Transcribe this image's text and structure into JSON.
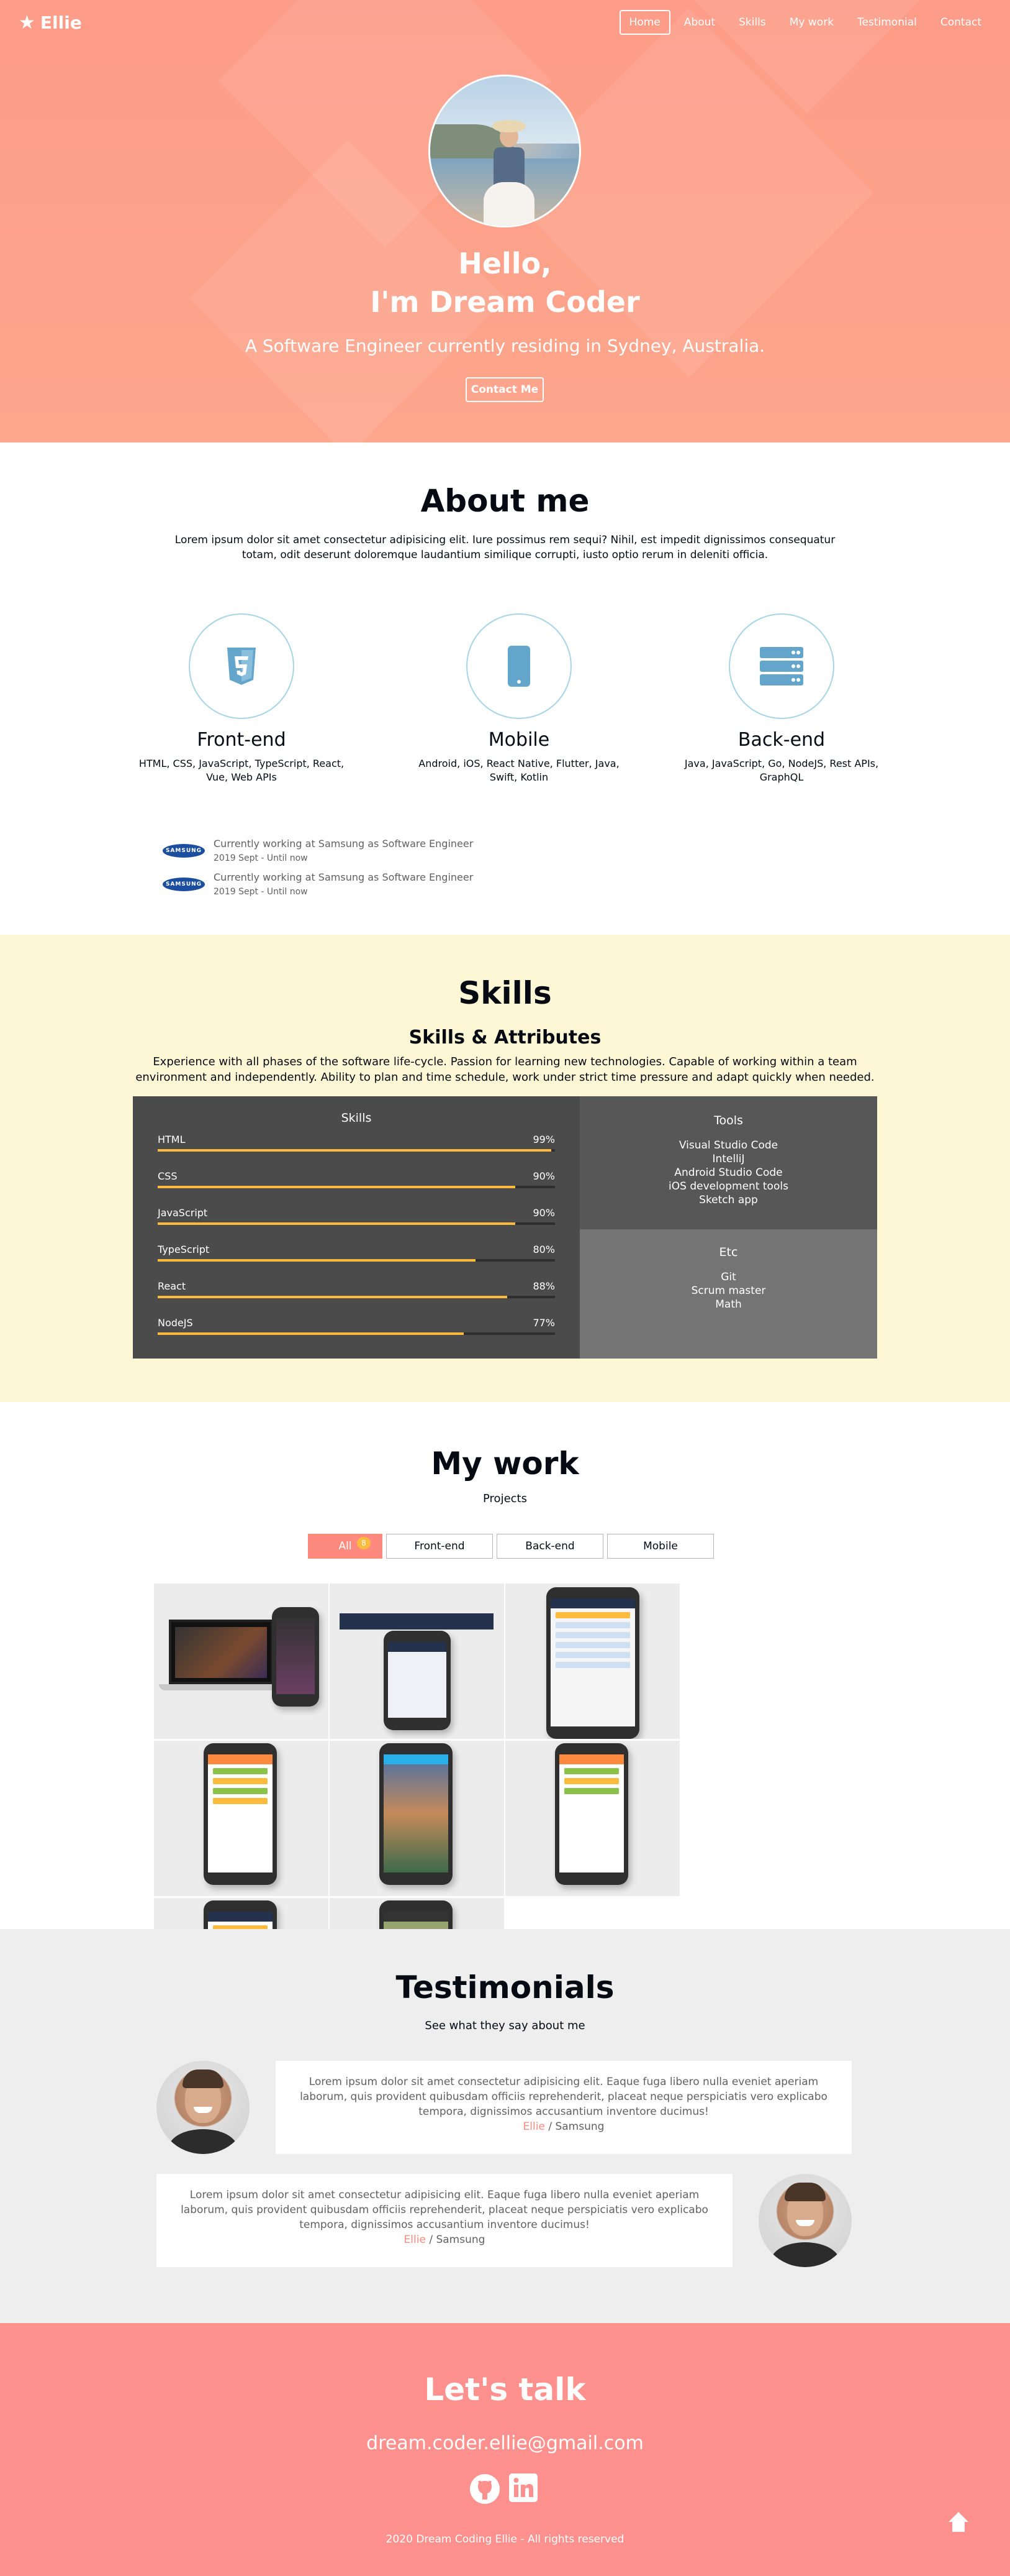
{
  "navbar": {
    "logo": "Ellie",
    "menu": [
      "Home",
      "About",
      "Skills",
      "My work",
      "Testimonial",
      "Contact"
    ]
  },
  "home": {
    "title_line1": "Hello,",
    "title_line2": "I'm Dream Coder",
    "description": "A Software Engineer currently residing in Sydney, Australia.",
    "contact_button": "Contact Me"
  },
  "about": {
    "title": "About me",
    "description": "Lorem ipsum dolor sit amet consectetur adipisicing elit. Iure possimus rem sequi? Nihil, est impedit dignissimos consequatur totam, odit deserunt doloremque laudantium similique corrupti, iusto optio rerum in deleniti officia.",
    "majors": [
      {
        "title": "Front-end",
        "desc": "HTML, CSS, JavaScript, TypeScript, React, Vue, Web APIs",
        "icon": "html5-icon"
      },
      {
        "title": "Mobile",
        "desc": "Android, iOS, React Native, Flutter, Java, Swift, Kotlin",
        "icon": "mobile-icon"
      },
      {
        "title": "Back-end",
        "desc": "Java, JavaScript, Go, NodeJS, Rest APIs, GraphQL",
        "icon": "server-icon"
      }
    ],
    "jobs": [
      {
        "logo": "SAMSUNG",
        "name": "Currently working at Samsung as Software Engineer",
        "period": "2019 Sept - Until now"
      },
      {
        "logo": "SAMSUNG",
        "name": "Currently working at Samsung as Software Engineer",
        "period": "2019 Sept - Until now"
      }
    ]
  },
  "skills": {
    "title": "Skills",
    "subtitle": "Skills & Attributes",
    "description": "Experience with all phases of the software life-cycle. Passion for learning new technologies. Capable of working within a team environment and independently. Ability to plan and time schedule, work under strict time pressure and adapt quickly when needed.",
    "coding_title": "Skills",
    "coding": [
      {
        "name": "HTML",
        "percent": "99%",
        "value": 99
      },
      {
        "name": "CSS",
        "percent": "90%",
        "value": 90
      },
      {
        "name": "JavaScript",
        "percent": "90%",
        "value": 90
      },
      {
        "name": "TypeScript",
        "percent": "80%",
        "value": 80
      },
      {
        "name": "React",
        "percent": "88%",
        "value": 88
      },
      {
        "name": "NodeJS",
        "percent": "77%",
        "value": 77
      }
    ],
    "tools_title": "Tools",
    "tools": [
      "Visual Studio Code",
      "IntelliJ",
      "Android Studio Code",
      "iOS development tools",
      "Sketch app"
    ],
    "etc_title": "Etc",
    "etc": [
      "Git",
      "Scrum master",
      "Math"
    ]
  },
  "work": {
    "title": "My work",
    "subtitle": "Projects",
    "categories": [
      {
        "label": "All",
        "count": "8"
      },
      {
        "label": "Front-end"
      },
      {
        "label": "Back-end"
      },
      {
        "label": "Mobile"
      }
    ]
  },
  "testimonials": {
    "title": "Testimonials",
    "subtitle": "See what they say about me",
    "items": [
      {
        "text": "Lorem ipsum dolor sit amet consectetur adipisicing elit. Eaque fuga libero nulla eveniet aperiam laborum, quis provident quibusdam officiis reprehenderit, placeat neque perspiciatis vero explicabo tempora, dignissimos accusantium inventore ducimus!",
        "name": "Ellie",
        "company": " / Samsung"
      },
      {
        "text": "Lorem ipsum dolor sit amet consectetur adipisicing elit. Eaque fuga libero nulla eveniet aperiam laborum, quis provident quibusdam officiis reprehenderit, placeat neque perspiciatis vero explicabo tempora, dignissimos accusantium inventore ducimus!",
        "name": "Ellie",
        "company": " / Samsung"
      }
    ]
  },
  "contact": {
    "title": "Let's talk",
    "email": "dream.coder.ellie@gmail.com",
    "rights": "2020 Dream Coding Ellie - All rights reserved"
  },
  "colors": {
    "accent": "#fd8a7e",
    "skill_bar": "#fdbb3e",
    "skills_bg": "#fef7d6",
    "contact_bg": "#fe918d"
  }
}
